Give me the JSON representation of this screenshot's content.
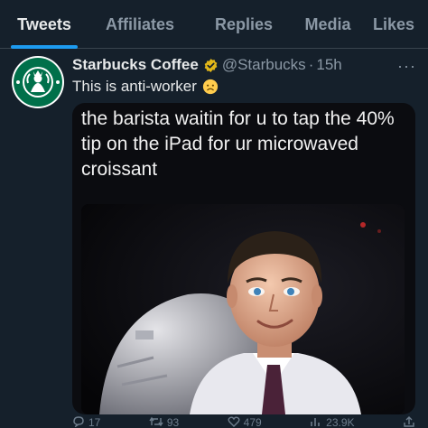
{
  "tabs": [
    "Tweets",
    "Affiliates",
    "Replies",
    "Media",
    "Likes"
  ],
  "tweet": {
    "display_name": "Starbucks Coffee",
    "handle": "@Starbucks",
    "separator": "·",
    "time": "15h",
    "text": "This is anti-worker",
    "emoji": "frowning-face-emoji",
    "more_icon": "more-horizontal-icon",
    "verified_icon": "verified-badge-icon",
    "media_caption": "the barista waitin for u to tap the 40% tip on the iPad for ur microwaved croissant",
    "media_image": "animatronic-man-figure-image"
  },
  "actions": [
    {
      "icon": "reply-icon",
      "count": "17"
    },
    {
      "icon": "retweet-icon",
      "count": "93"
    },
    {
      "icon": "like-icon",
      "count": "479"
    },
    {
      "icon": "views-icon",
      "count": "23.9K"
    },
    {
      "icon": "share-icon",
      "count": ""
    }
  ],
  "colors": {
    "background": "#15202b",
    "accent": "#1d9bf0",
    "muted": "#8b98a5",
    "verified_gold": "#e2b719",
    "starbucks_green": "#00704a"
  }
}
